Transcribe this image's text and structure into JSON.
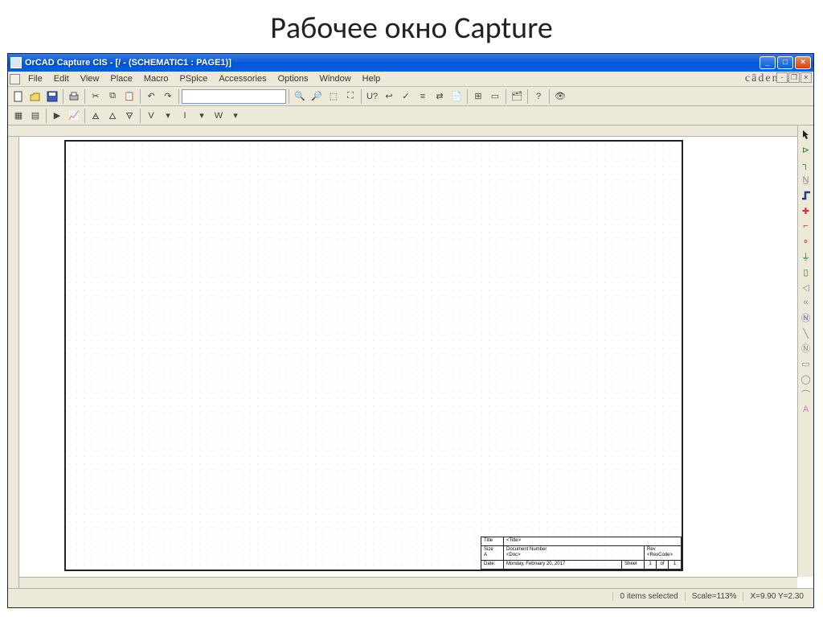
{
  "slide": {
    "title": "Рабочее окно Capture"
  },
  "titlebar": {
    "text": "OrCAD Capture CIS - [/ - (SCHEMATIC1 : PAGE1)]"
  },
  "brand": "cādence",
  "menubar": {
    "items": [
      "File",
      "Edit",
      "View",
      "Place",
      "Macro",
      "PSpice",
      "Accessories",
      "Options",
      "Window",
      "Help"
    ]
  },
  "toolbar2_labels": {
    "v": "V",
    "i": "I",
    "w": "W"
  },
  "title_block": {
    "title_label": "Title",
    "title_value": "<Title>",
    "size_label": "Size",
    "size_value": "A",
    "docnum_label": "Document Number",
    "docnum_value": "<Doc>",
    "rev_label": "Rev",
    "rev_value": "<RevCode>",
    "date_label": "Date:",
    "date_value": "Monday, February 20, 2017",
    "sheet_label": "Sheet",
    "sheet_cur": "1",
    "sheet_of": "of",
    "sheet_total": "1"
  },
  "statusbar": {
    "selected": "0 items selected",
    "scale": "Scale=113%",
    "coords": "X=9.90  Y=2.30"
  },
  "palette_icons": [
    "pointer",
    "place-part",
    "wire",
    "net-alias",
    "bus",
    "junction",
    "bus-entry",
    "power",
    "ground",
    "hier-block",
    "port",
    "off-page",
    "no-connect",
    "line",
    "polyline",
    "rectangle",
    "ellipse",
    "arc",
    "text"
  ]
}
